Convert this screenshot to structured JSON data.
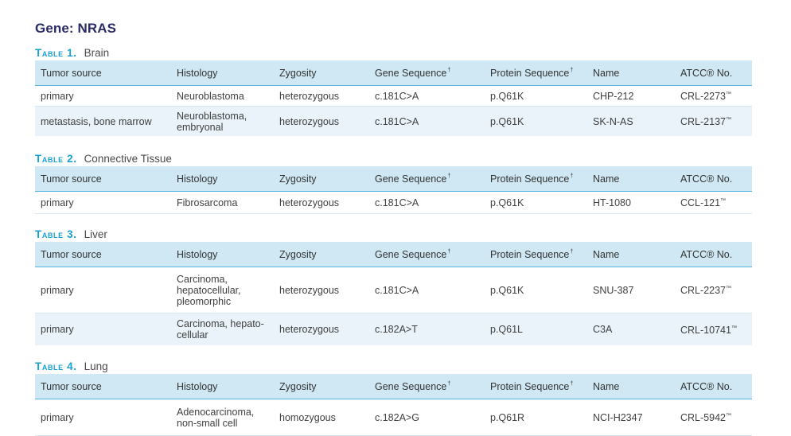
{
  "gene_title": "Gene: NRAS",
  "headers": {
    "tumor_source": "Tumor source",
    "histology": "Histology",
    "zygosity": "Zygosity",
    "gene_sequence": "Gene Sequence",
    "protein_sequence": "Protein Sequence",
    "name": "Name",
    "atcc_no": "ATCC® No.",
    "dagger": "†"
  },
  "tables": [
    {
      "label": "Table 1.",
      "name": "Brain",
      "rows": [
        {
          "tumor_source": "primary",
          "histology": "Neuroblastoma",
          "zygosity": "heterozygous",
          "gene_sequence": "c.181C>A",
          "protein_sequence": "p.Q61K",
          "name": "CHP-212",
          "atcc_no": "CRL-2273",
          "tm": "™"
        },
        {
          "tumor_source": "metastasis, bone marrow",
          "histology": "Neuroblastoma, embryonal",
          "zygosity": "heterozygous",
          "gene_sequence": "c.181C>A",
          "protein_sequence": "p.Q61K",
          "name": "SK-N-AS",
          "atcc_no": "CRL-2137",
          "tm": "™"
        }
      ]
    },
    {
      "label": "Table 2.",
      "name": "Connective Tissue",
      "rows": [
        {
          "tumor_source": "primary",
          "histology": "Fibrosarcoma",
          "zygosity": "heterozygous",
          "gene_sequence": "c.181C>A",
          "protein_sequence": "p.Q61K",
          "name": "HT-1080",
          "atcc_no": "CCL-121",
          "tm": "™"
        }
      ]
    },
    {
      "label": "Table 3.",
      "name": "Liver",
      "rows": [
        {
          "tumor_source": "primary",
          "histology": "Carcinoma, hepatocellular, pleomorphic",
          "zygosity": "heterozygous",
          "gene_sequence": "c.181C>A",
          "protein_sequence": "p.Q61K",
          "name": "SNU-387",
          "atcc_no": "CRL-2237",
          "tm": "™"
        },
        {
          "tumor_source": "primary",
          "histology": "Carcinoma, hepato-cellular",
          "zygosity": "heterozygous",
          "gene_sequence": "c.182A>T",
          "protein_sequence": "p.Q61L",
          "name": "C3A",
          "atcc_no": "CRL-10741",
          "tm": "™"
        }
      ]
    },
    {
      "label": "Table 4.",
      "name": "Lung",
      "rows": [
        {
          "tumor_source": "primary",
          "histology": "Adenocarcinoma, non-small cell",
          "zygosity": "homozygous",
          "gene_sequence": "c.182A>G",
          "protein_sequence": "p.Q61R",
          "name": "NCI-H2347",
          "atcc_no": "CRL-5942",
          "tm": "™"
        }
      ]
    }
  ]
}
